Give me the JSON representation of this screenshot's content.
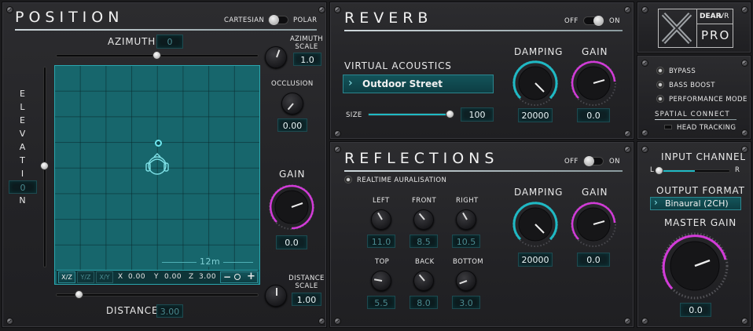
{
  "position": {
    "title": "POSITION",
    "mode_left": "CARTESIAN",
    "mode_right": "POLAR",
    "azimuth_label": "AZIMUTH",
    "azimuth_value": "0",
    "azimuth_scale_label": "AZIMUTH SCALE",
    "azimuth_scale_value": "1.0",
    "occlusion_label": "OCCLUSION",
    "occlusion_value": "0.00",
    "gain_label": "GAIN",
    "gain_value": "0.0",
    "elevation_label": "ELEVATION",
    "elevation_value": "0",
    "distance_label": "DISTANCE",
    "distance_value": "3.00",
    "distance_scale_label": "DISTANCE SCALE",
    "distance_scale_value": "1.00",
    "grid_scale_label": "12m",
    "view_buttons": [
      "X/Z",
      "Y/Z",
      "X/Y"
    ],
    "coord_x_label": "X",
    "coord_x_value": "0.00",
    "coord_y_label": "Y",
    "coord_y_value": "0.00",
    "coord_z_label": "Z",
    "coord_z_value": "3.00",
    "zoom_minus": "−",
    "zoom_plus": "+"
  },
  "reverb": {
    "title": "REVERB",
    "off_label": "OFF",
    "on_label": "ON",
    "virtual_acoustics_label": "VIRTUAL ACOUSTICS",
    "preset_value": "Outdoor Street",
    "size_label": "SIZE",
    "size_value": "100",
    "size_level": 0.95,
    "damping_label": "DAMPING",
    "damping_value": "20000",
    "gain_label": "GAIN",
    "gain_value": "0.0"
  },
  "reflections": {
    "title": "REFLECTIONS",
    "off_label": "OFF",
    "on_label": "ON",
    "realtime_label": "REALTIME AURALISATION",
    "left_label": "LEFT",
    "left_value": "11.0",
    "front_label": "FRONT",
    "front_value": "8.5",
    "right_label": "RIGHT",
    "right_value": "10.5",
    "top_label": "TOP",
    "top_value": "5.5",
    "back_label": "BACK",
    "back_value": "8.0",
    "bottom_label": "BOTTOM",
    "bottom_value": "3.0",
    "damping_label": "DAMPING",
    "damping_value": "20000",
    "gain_label": "GAIN",
    "gain_value": "0.0"
  },
  "brand": {
    "line1": "DEAR",
    "line1b": "VR",
    "line2": "PRO"
  },
  "options": {
    "bypass": "BYPASS",
    "bass_boost": "BASS BOOST",
    "performance_mode": "PERFORMANCE MODE",
    "spatial_connect": "SPATIAL CONNECT",
    "head_tracking": "HEAD TRACKING"
  },
  "output": {
    "input_channel_label": "INPUT CHANNEL",
    "left_label": "L",
    "right_label": "R",
    "output_format_label": "OUTPUT FORMAT",
    "output_format_value": "Binaural (2CH)",
    "master_gain_label": "MASTER GAIN",
    "master_gain_value": "0.0"
  },
  "colors": {
    "teal": "#1fb9c4",
    "magenta": "#d23bd8",
    "grid_bg": "#1c6c72"
  }
}
